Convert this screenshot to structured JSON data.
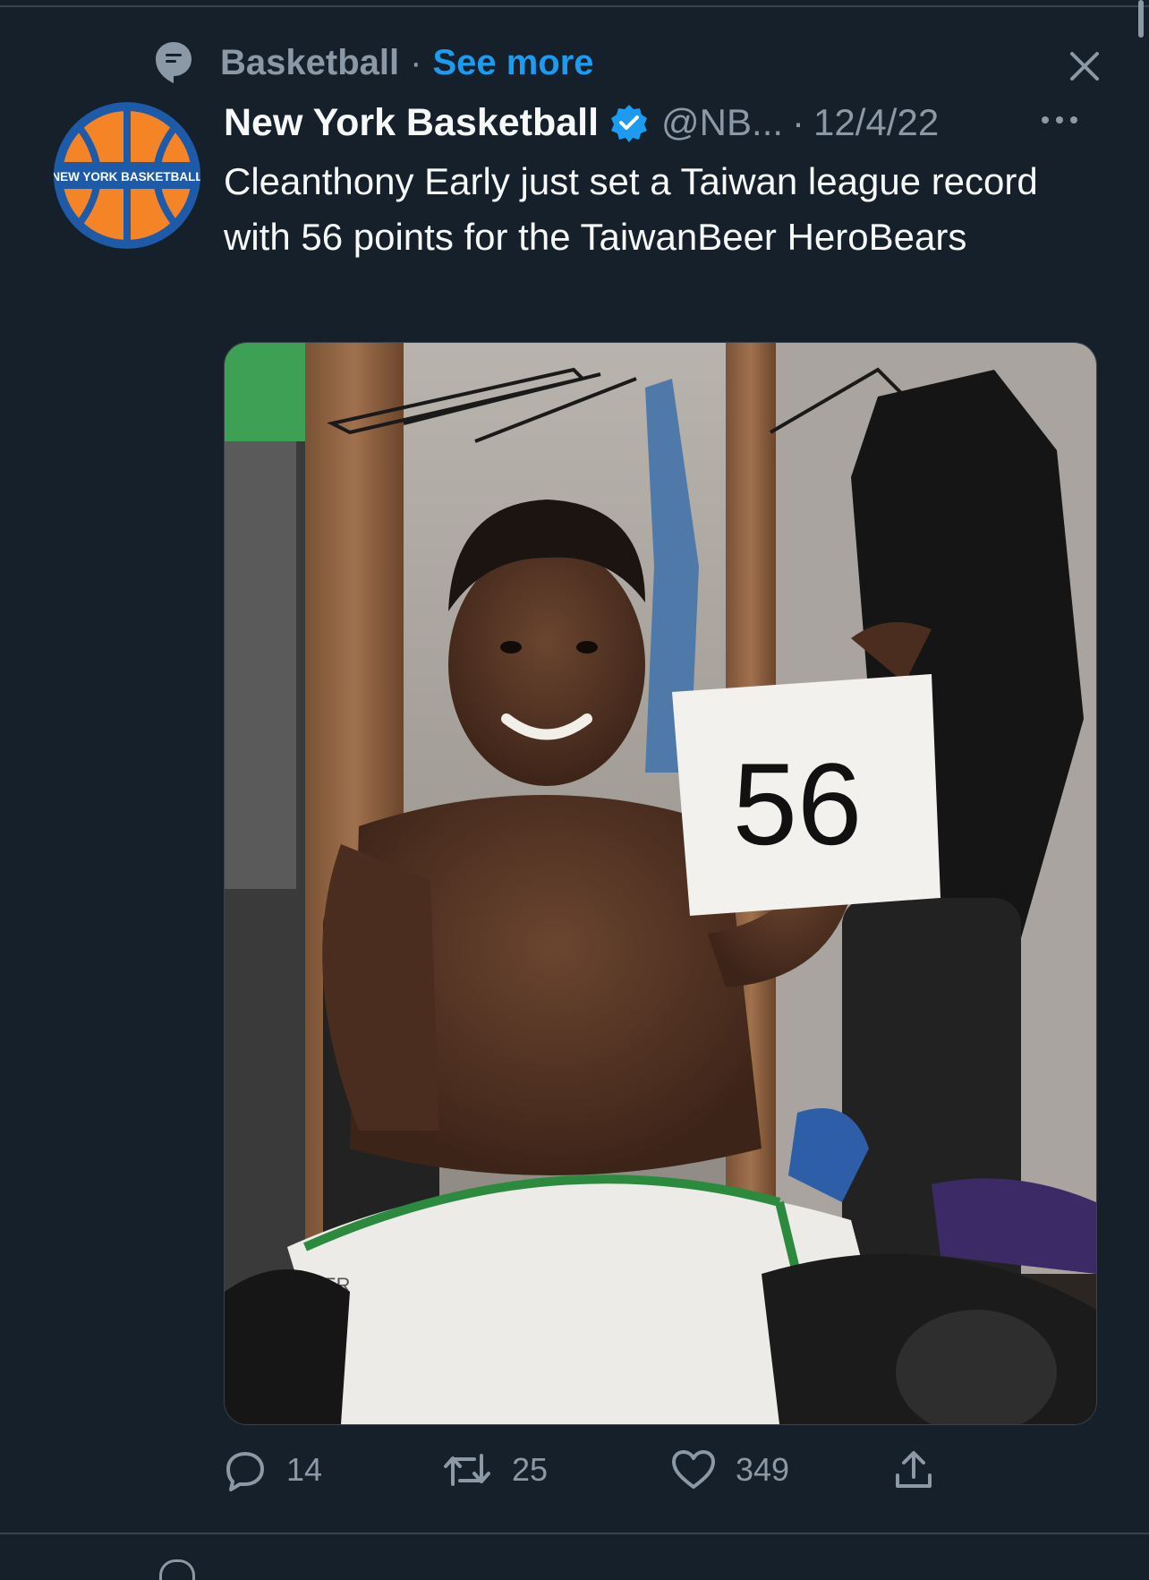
{
  "context": {
    "topic": "Basketball",
    "separator": "·",
    "see_more": "See more"
  },
  "icons": {
    "topic": "topic-bubble-icon",
    "close": "close-icon",
    "verified": "verified-badge-icon",
    "more": "more-options-icon",
    "reply": "reply-icon",
    "retweet": "retweet-icon",
    "like": "heart-icon",
    "share": "share-icon"
  },
  "tweet": {
    "avatar_text": "NEW YORK BASKETBALL",
    "display_name": "New York Basketball",
    "handle": "@NB...",
    "separator": "·",
    "date": "12/4/22",
    "text": "Cleanthony Early just set a Taiwan league record with 56 points for the TaiwanBeer HeroBears",
    "media": {
      "sign_text": "56",
      "shorts_text": "ER"
    }
  },
  "actions": {
    "replies": "14",
    "retweets": "25",
    "likes": "349"
  },
  "colors": {
    "background": "#15202b",
    "accent": "#1d9bf0",
    "muted": "#8b98a5",
    "avatar_orange": "#f58426",
    "avatar_blue": "#1d5aa8"
  }
}
